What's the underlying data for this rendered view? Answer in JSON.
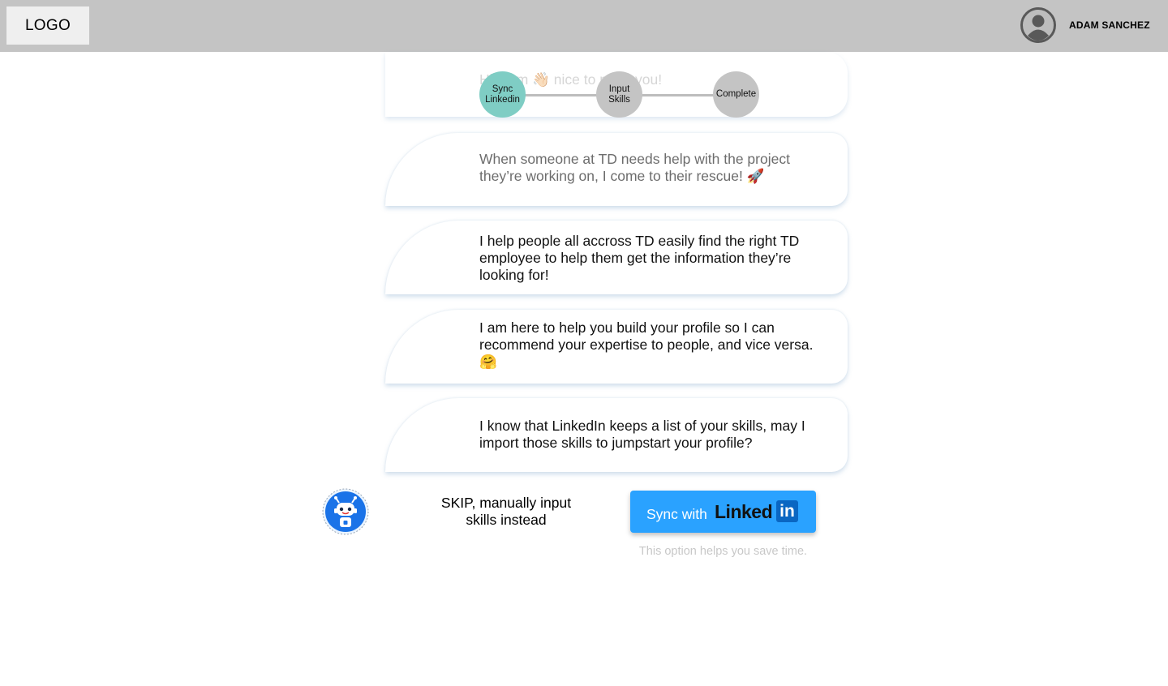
{
  "header": {
    "logo": "LOGO",
    "username": "ADAM SANCHEZ",
    "avatar_icon": "user-avatar-icon"
  },
  "stepper": {
    "steps": [
      {
        "label": "Sync Linkedin",
        "state": "active"
      },
      {
        "label": "Input Skills",
        "state": "inactive"
      },
      {
        "label": "Complete",
        "state": "inactive"
      }
    ],
    "active_color": "#7fcdc4",
    "inactive_color": "#c4c4c4"
  },
  "messages": [
    {
      "text": "Hi, I am 👋🏻 nice to meet you!"
    },
    {
      "text": "When someone at TD needs help with the project they’re working on, I come to their rescue! 🚀"
    },
    {
      "text": "I help people all accross TD easily find the right TD employee to help them get the information they’re looking for!"
    },
    {
      "text": "I am here to help you build your profile so I can recommend your expertise to people, and vice versa. 🤗"
    },
    {
      "text": "I know that LinkedIn keeps a list of your skills, may I import those skills to jumpstart your profile?"
    }
  ],
  "actions": {
    "skip_label": "SKIP, manually input skills instead",
    "sync_label": "Sync with",
    "linkedin_word": "Linked",
    "linkedin_in": "in",
    "hint": "This option helps you save time.",
    "button_color": "#2aa2ff",
    "linkedin_color": "#0a66c2"
  },
  "bot": {
    "icon": "robot-icon"
  }
}
